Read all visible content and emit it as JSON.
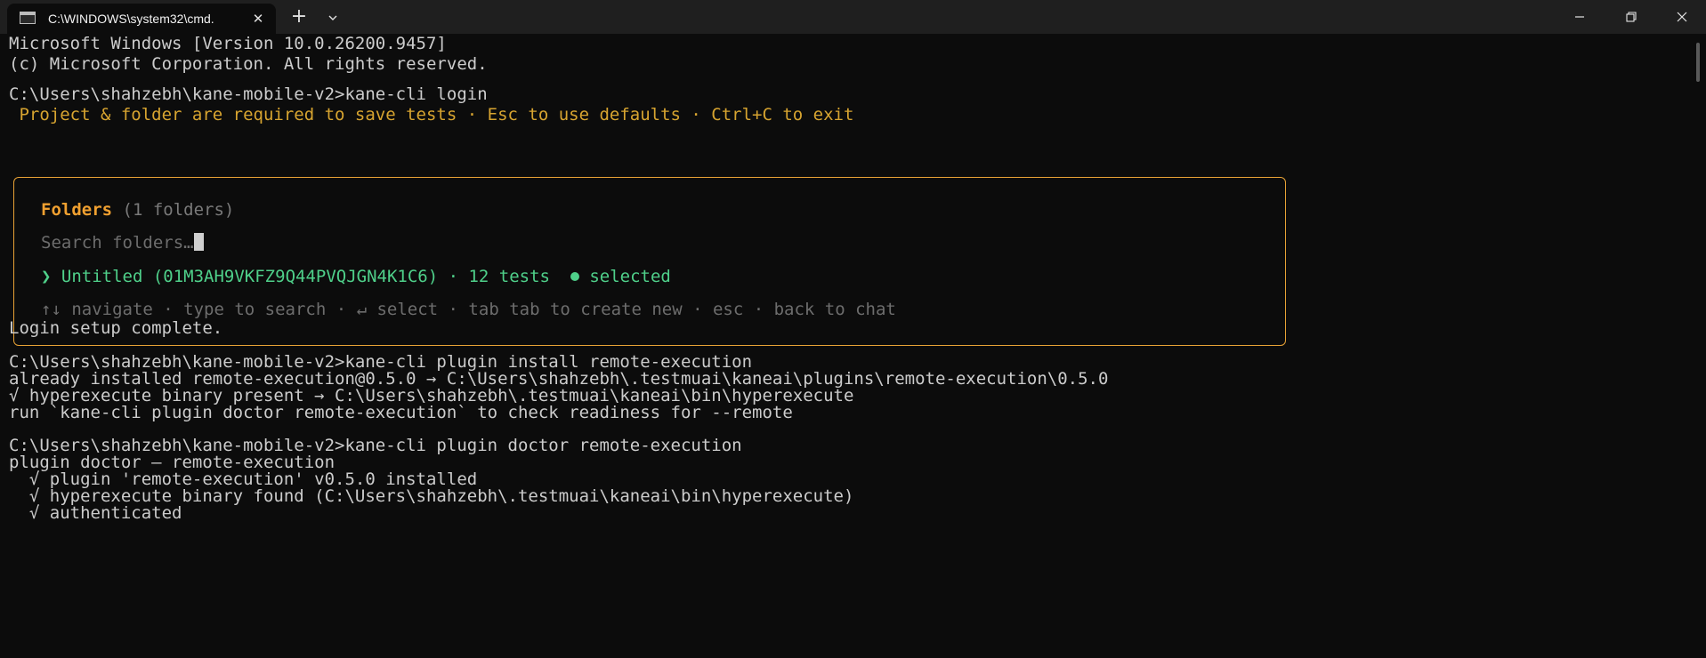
{
  "window": {
    "tab_title": "C:\\WINDOWS\\system32\\cmd.",
    "tab_icon": "cmd-console-icon",
    "new_tab_label": "+",
    "close_tab_label": "✕"
  },
  "colors": {
    "background": "#0c0c0c",
    "text": "#cccccc",
    "hint": "#d7a430",
    "panel_border": "#e8a235",
    "panel_title": "#f0a030",
    "selected": "#4fd08a",
    "muted": "#6d6d6d"
  },
  "terminal": {
    "header": [
      "Microsoft Windows [Version 10.0.26200.9457]",
      "(c) Microsoft Corporation. All rights reserved."
    ],
    "cmd_login": "C:\\Users\\shahzebh\\kane-mobile-v2>kane-cli login",
    "login_hint": " Project & folder are required to save tests · Esc to use defaults · Ctrl+C to exit",
    "panel": {
      "title": "Folders",
      "count": "(1 folders)",
      "search_placeholder": "Search folders…",
      "item_marker": "❯",
      "item_text": "Untitled (01M3AH9VKFZ9Q44PVQJGN4K1C6) · 12 tests",
      "item_status": "selected",
      "help": "↑↓ navigate · type to search · ↵ select · tab tab to create new · esc · back to chat"
    },
    "login_done": "Login setup complete.",
    "cmd_install": "C:\\Users\\shahzebh\\kane-mobile-v2>kane-cli plugin install remote-execution",
    "install_output": [
      "already installed remote-execution@0.5.0 → C:\\Users\\shahzebh\\.testmuai\\kaneai\\plugins\\remote-execution\\0.5.0",
      "√ hyperexecute binary present → C:\\Users\\shahzebh\\.testmuai\\kaneai\\bin\\hyperexecute",
      "run `kane-cli plugin doctor remote-execution` to check readiness for --remote"
    ],
    "cmd_doctor": "C:\\Users\\shahzebh\\kane-mobile-v2>kane-cli plugin doctor remote-execution",
    "doctor_output": [
      "plugin doctor — remote-execution",
      "  √ plugin 'remote-execution' v0.5.0 installed",
      "  √ hyperexecute binary found (C:\\Users\\shahzebh\\.testmuai\\kaneai\\bin\\hyperexecute)",
      "  √ authenticated"
    ]
  }
}
